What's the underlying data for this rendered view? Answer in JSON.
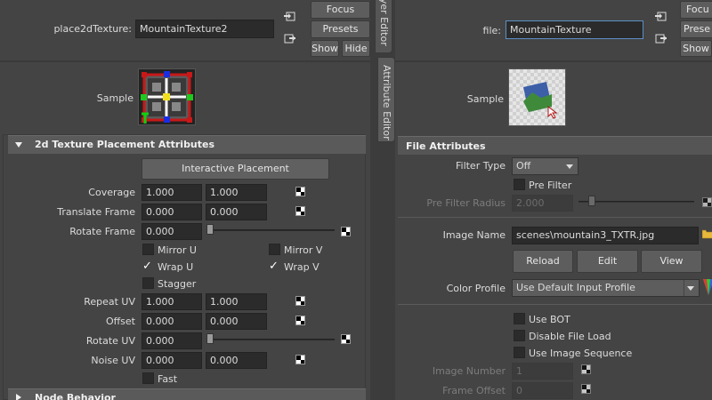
{
  "left": {
    "node_label": "place2dTexture:",
    "node_value": "MountainTexture2",
    "focus": "Focus",
    "presets": "Presets",
    "show": "Show",
    "hide": "Hide",
    "sample_label": "Sample",
    "section_title": "2d Texture Placement Attributes",
    "interactive_placement": "Interactive Placement",
    "coverage": {
      "label": "Coverage",
      "v1": "1.000",
      "v2": "1.000"
    },
    "translate_frame": {
      "label": "Translate Frame",
      "v1": "0.000",
      "v2": "0.000"
    },
    "rotate_frame": {
      "label": "Rotate Frame",
      "v1": "0.000"
    },
    "mirror_u": "Mirror U",
    "mirror_v": "Mirror V",
    "wrap_u": "Wrap U",
    "wrap_v": "Wrap V",
    "stagger": "Stagger",
    "repeat_uv": {
      "label": "Repeat UV",
      "v1": "1.000",
      "v2": "1.000"
    },
    "offset": {
      "label": "Offset",
      "v1": "0.000",
      "v2": "0.000"
    },
    "rotate_uv": {
      "label": "Rotate UV",
      "v1": "0.000"
    },
    "noise_uv": {
      "label": "Noise UV",
      "v1": "0.000",
      "v2": "0.000"
    },
    "fast": "Fast",
    "node_behavior": "Node Behavior"
  },
  "tabs": {
    "layer_editor": "Layer Editor",
    "attribute_editor": "Attribute Editor"
  },
  "right": {
    "file_label": "file:",
    "file_value": "MountainTexture",
    "focus": "Focu",
    "presets": "Prese",
    "show": "Show",
    "sample_label": "Sample",
    "section_title": "File Attributes",
    "filter_type": {
      "label": "Filter Type",
      "value": "Off"
    },
    "pre_filter": "Pre Filter",
    "pre_filter_radius": {
      "label": "Pre Filter Radius",
      "value": "2.000"
    },
    "image_name": {
      "label": "Image Name",
      "value": "scenes\\mountain3_TXTR.jpg"
    },
    "reload": "Reload",
    "edit": "Edit",
    "view": "View",
    "color_profile": {
      "label": "Color Profile",
      "value": "Use Default Input Profile"
    },
    "use_bot": "Use BOT",
    "disable_file_load": "Disable File Load",
    "use_image_sequence": "Use Image Sequence",
    "image_number": {
      "label": "Image Number",
      "value": "1"
    },
    "frame_offset": {
      "label": "Frame Offset",
      "value": "0"
    }
  }
}
